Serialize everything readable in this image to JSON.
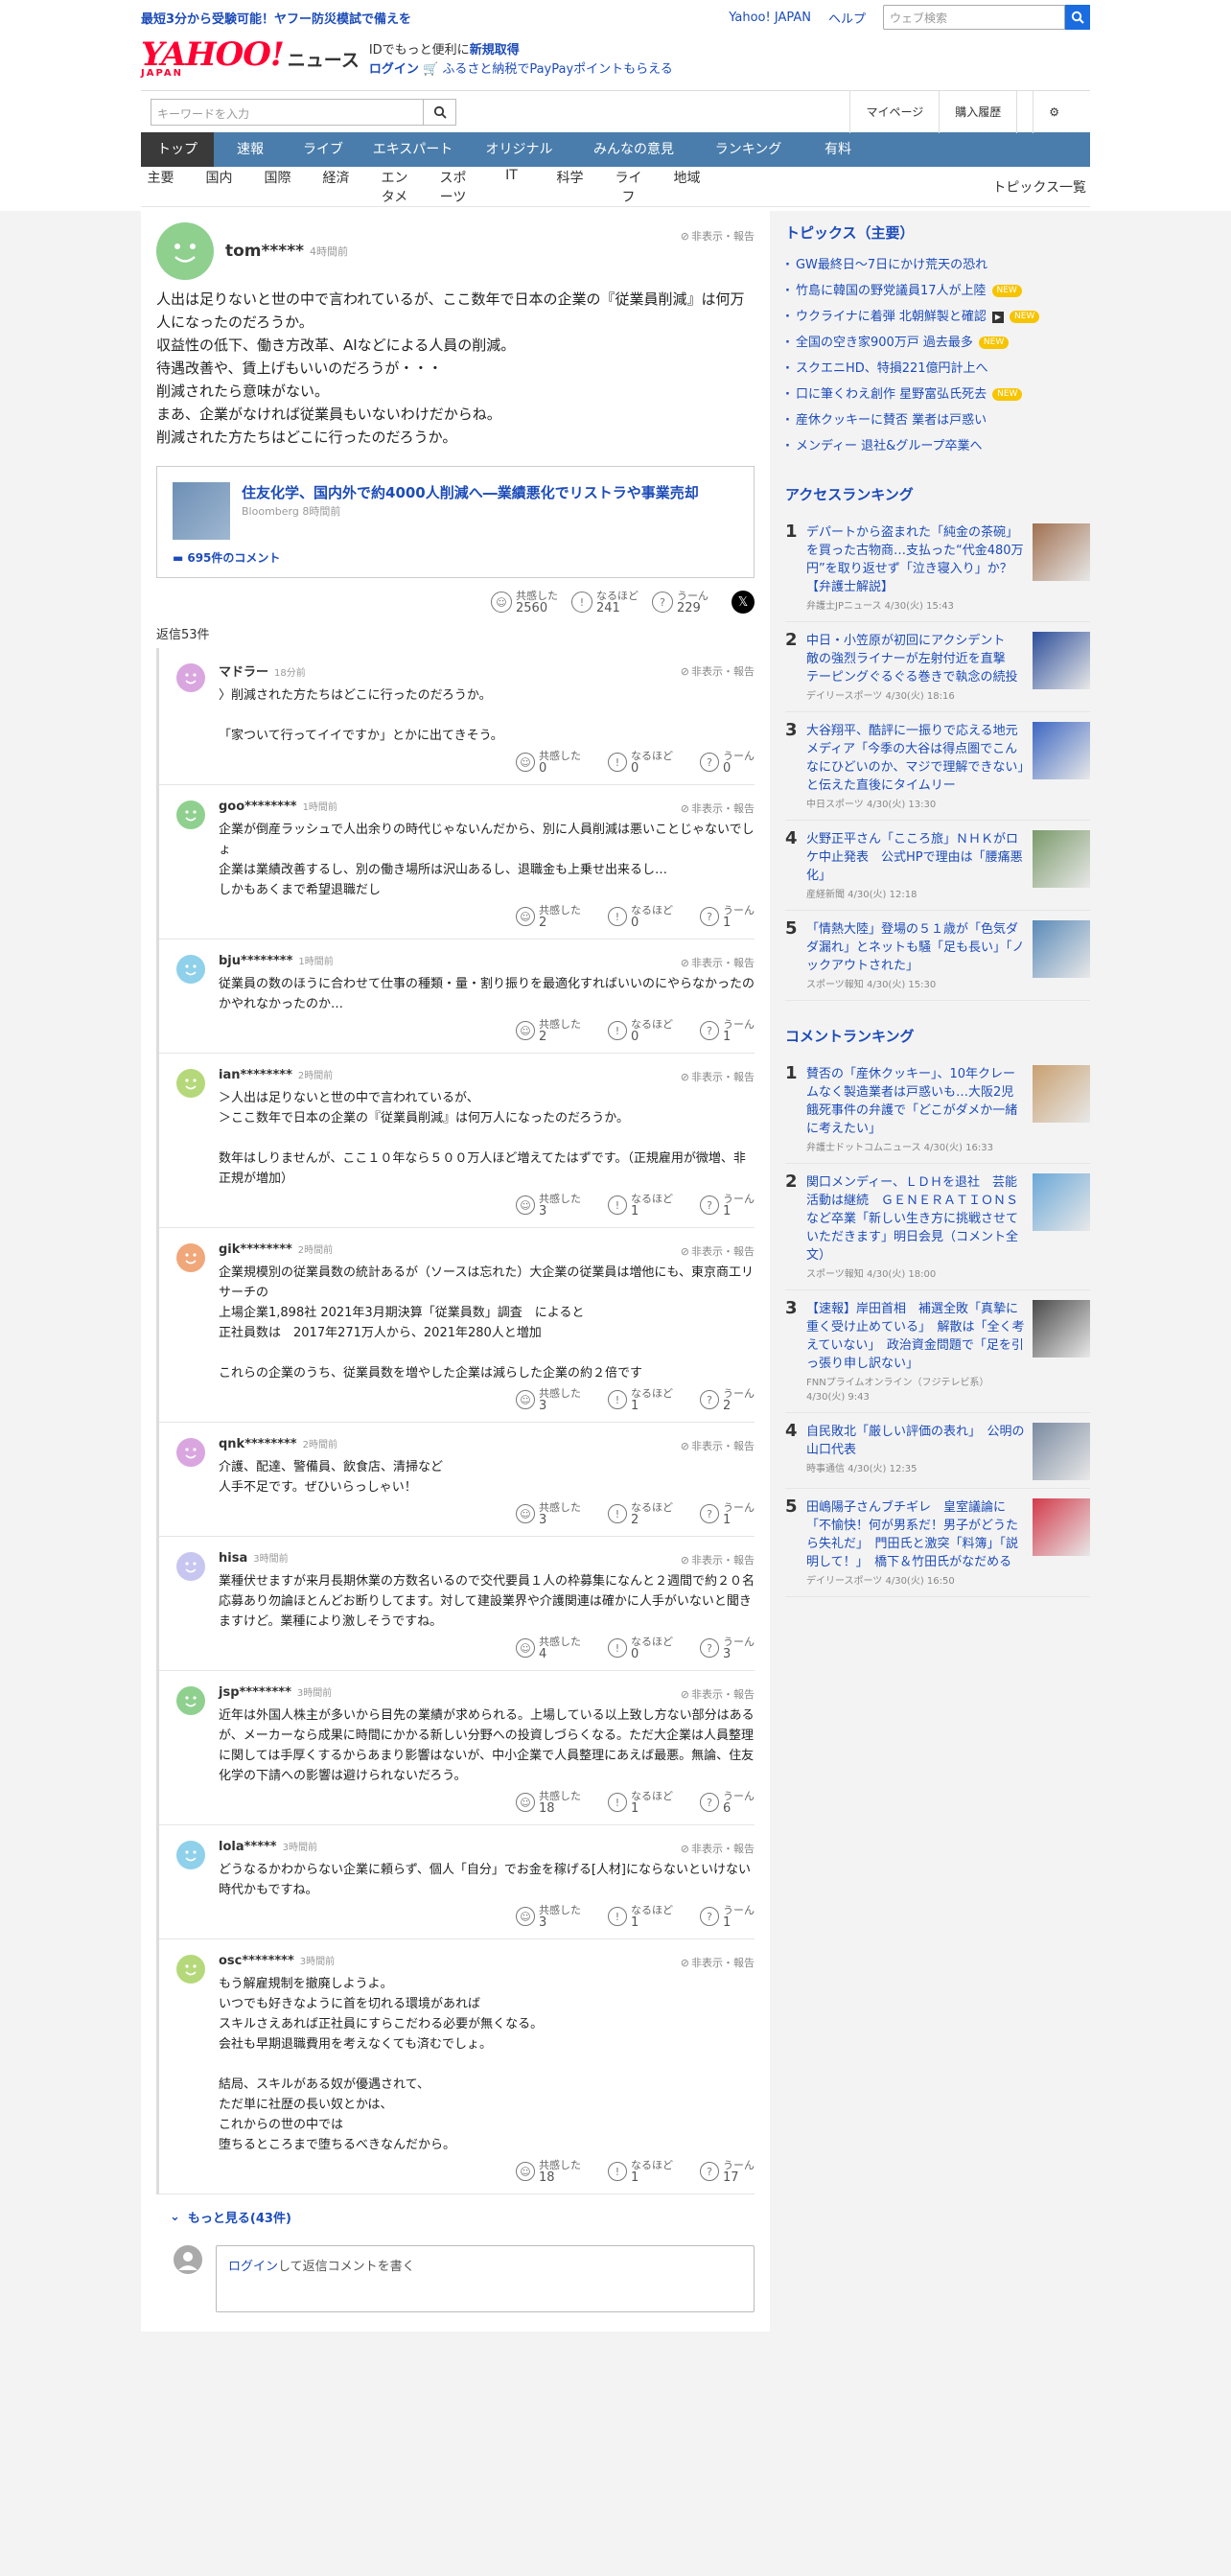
{
  "promo_link": "最短3分から受験可能！ヤフー防災模試で備えを",
  "top_links": [
    "Yahoo! JAPAN",
    "ヘルプ"
  ],
  "web_search_placeholder": "ウェブ検索",
  "logo": {
    "main": "YAHOO!",
    "sub": "JAPAN",
    "section": "ニュース"
  },
  "header_promo": {
    "line1a": "IDでもっと便利に",
    "line1b": "新規取得",
    "login": "ログイン",
    "line2": "ふるさと納税でPayPayポイントもらえる"
  },
  "keyword_placeholder": "キーワードを入力",
  "util_links": [
    "マイページ",
    "購入履歴"
  ],
  "gnav": [
    "トップ",
    "速報",
    "ライブ",
    "エキスパート",
    "オリジナル",
    "みんなの意見",
    "ランキング",
    "有料"
  ],
  "snav": [
    "主要",
    "国内",
    "国際",
    "経済",
    "エンタメ",
    "スポーツ",
    "IT",
    "科学",
    "ライフ",
    "地域"
  ],
  "topics_list_label": "トピックス一覧",
  "hide_report": "非表示・報告",
  "reaction_labels": [
    "共感した",
    "なるほど",
    "うーん"
  ],
  "post": {
    "user": "tom*****",
    "time": "4時間前",
    "text": "人出は足りないと世の中で言われているが、ここ数年で日本の企業の『従業員削減』は何万人になったのだろうか。\n収益性の低下、働き方改革、AIなどによる人員の削減。\n待遇改善や、賃上げもいいのだろうが・・・\n削減されたら意味がない。\nまあ、企業がなければ従業員もいないわけだからね。\n削減された方たちはどこに行ったのだろうか。",
    "article_title": "住友化学、国内外で約4000人削減へ―業績悪化でリストラや事業売却",
    "article_source": "Bloomberg 8時間前",
    "comments": "695件のコメント",
    "reactions": [
      "2560",
      "241",
      "229"
    ]
  },
  "reply_count": "返信53件",
  "replies": [
    {
      "user": "マドラー",
      "time": "18分前",
      "text": "〉削減された方たちはどこに行ったのだろうか。\n\n「家ついて行ってイイですか」とかに出てきそう。",
      "r": [
        "0",
        "0",
        "0"
      ],
      "color": "#d9a6e0"
    },
    {
      "user": "goo********",
      "time": "1時間前",
      "text": "企業が倒産ラッシュで人出余りの時代じゃないんだから、別に人員削減は悪いことじゃないでしょ\n企業は業績改善するし、別の働き場所は沢山あるし、退職金も上乗せ出来るし…\nしかもあくまで希望退職だし",
      "r": [
        "2",
        "0",
        "1"
      ],
      "color": "#8fd08f"
    },
    {
      "user": "bju********",
      "time": "1時間前",
      "text": "従業員の数のほうに合わせて仕事の種類・量・割り振りを最適化すればいいのにやらなかったのかやれなかったのか…",
      "r": [
        "2",
        "0",
        "1"
      ],
      "color": "#8fd0ea"
    },
    {
      "user": "ian********",
      "time": "2時間前",
      "text": "＞人出は足りないと世の中で言われているが、\n＞ここ数年で日本の企業の『従業員削減』は何万人になったのだろうか。\n\n数年はしりませんが、ここ１０年なら５００万人ほど増えてたはずです。（正規雇用が微増、非正規が増加）",
      "r": [
        "3",
        "1",
        "1"
      ],
      "color": "#b5d97a"
    },
    {
      "user": "gik********",
      "time": "2時間前",
      "text": "企業規模別の従業員数の統計あるが（ソースは忘れた）大企業の従業員は増他にも、東京商工リサーチの\n上場企業1,898社 2021年3月期決算「従業員数」調査　によると\n正社員数は　2017年271万人から、2021年280人と増加\n\nこれらの企業のうち、従業員数を増やした企業は減らした企業の約２倍です",
      "r": [
        "3",
        "1",
        "2"
      ],
      "color": "#f0a77a"
    },
    {
      "user": "qnk********",
      "time": "2時間前",
      "text": "介護、配達、警備員、飲食店、清掃など\n人手不足です。ぜひいらっしゃい！",
      "r": [
        "3",
        "2",
        "1"
      ],
      "color": "#d9a6e0"
    },
    {
      "user": "hisa",
      "time": "3時間前",
      "text": "業種伏せますが来月長期休業の方数名いるので交代要員１人の枠募集になんと２週間で約２０名応募あり勿論ほとんどお断りしてます。対して建設業界や介護関連は確かに人手がいないと聞きますけど。業種により激しそうですね。",
      "r": [
        "4",
        "0",
        "3"
      ],
      "color": "#c6c6f0"
    },
    {
      "user": "jsp********",
      "time": "3時間前",
      "text": "近年は外国人株主が多いから目先の業績が求められる。上場している以上致し方ない部分はあるが、メーカーなら成果に時間にかかる新しい分野への投資しづらくなる。ただ大企業は人員整理に関しては手厚くするからあまり影響はないが、中小企業で人員整理にあえば最悪。無論、住友化学の下請への影響は避けられないだろう。",
      "r": [
        "18",
        "1",
        "6"
      ],
      "color": "#8fd08f"
    },
    {
      "user": "lola*****",
      "time": "3時間前",
      "text": "どうなるかわからない企業に頼らず、個人「自分」でお金を稼げる[人材]にならないといけない時代かもですね。",
      "r": [
        "3",
        "1",
        "1"
      ],
      "color": "#8fd0ea"
    },
    {
      "user": "osc********",
      "time": "3時間前",
      "text": "もう解雇規制を撤廃しようよ。\nいつでも好きなように首を切れる環境があれば\nスキルさえあれば正社員にすらこだわる必要が無くなる。\n会社も早期退職費用を考えなくても済むでしょ。\n\n結局、スキルがある奴が優遇されて、\nただ単に社歴の長い奴とかは、\nこれからの世の中では\n堕ちるところまで堕ちるべきなんだから。",
      "r": [
        "18",
        "1",
        "17"
      ],
      "color": "#b5d97a"
    }
  ],
  "more_label": "もっと見る(43件)",
  "write": {
    "login": "ログイン",
    "rest": "して返信コメントを書く"
  },
  "topics": {
    "title": "トピックス（主要）",
    "items": [
      {
        "t": "GW最終日〜7日にかけ荒天の恐れ",
        "badge": ""
      },
      {
        "t": "竹島に韓国の野党議員17人が上陸",
        "badge": "NEW"
      },
      {
        "t": "ウクライナに着弾 北朝鮮製と確認",
        "badge": "NEW",
        "video": "▶"
      },
      {
        "t": "全国の空き家900万戸 過去最多",
        "badge": "NEW"
      },
      {
        "t": "スクエニHD、特損221億円計上へ",
        "badge": ""
      },
      {
        "t": "口に筆くわえ創作 星野富弘氏死去",
        "badge": "NEW"
      },
      {
        "t": "産休クッキーに賛否 業者は戸惑い",
        "badge": ""
      },
      {
        "t": "メンディー 退社&グループ卒業へ",
        "badge": ""
      }
    ]
  },
  "access": {
    "title": "アクセスランキング",
    "items": [
      {
        "n": "1",
        "t": "デパートから盗まれた「純金の茶碗」を買った古物商…支払った“代金480万円”を取り返せず「泣き寝入り」か？【弁護士解説】",
        "s": "弁護士JPニュース 4/30(火) 15:43",
        "c": "#a07050"
      },
      {
        "n": "2",
        "t": "中日・小笠原が初回にアクシデント　敵の強烈ライナーが左射付近を直撃　テーピングぐるぐる巻きで執念の続投",
        "s": "デイリースポーツ 4/30(火) 18:16",
        "c": "#2d4e9a"
      },
      {
        "n": "3",
        "t": "大谷翔平、酷評に一振りで応える地元メディア「今季の大谷は得点圏でこんなにひどいのか、マジで理解できない」と伝えた直後にタイムリー",
        "s": "中日スポーツ 4/30(火) 13:30",
        "c": "#3d67c2"
      },
      {
        "n": "4",
        "t": "火野正平さん「こころ旅」ＮＨＫがロケ中止発表　公式HPで理由は「腰痛悪化」",
        "s": "産経新聞 4/30(火) 12:18",
        "c": "#7a9a6a"
      },
      {
        "n": "5",
        "t": "「情熱大陸」登場の５１歳が「色気ダダ漏れ」とネットも騒「足も長い」「ノックアウトされた」",
        "s": "スポーツ報知 4/30(火) 15:30",
        "c": "#5a8ab8"
      }
    ]
  },
  "comment_rank": {
    "title": "コメントランキング",
    "items": [
      {
        "n": "1",
        "t": "賛否の「産休クッキー」、10年クレームなく製造業者は戸惑いも…大阪2児餓死事件の弁護で「どこがダメか一緒に考えたい」",
        "s": "弁護士ドットコムニュース 4/30(火) 16:33",
        "c": "#c8a070"
      },
      {
        "n": "2",
        "t": "関口メンディー、ＬＤＨを退社　芸能活動は継続　ＧＥＮＥＲＡＴＩＯＮＳなど卒業「新しい生き方に挑戦させていただきます」明日会見（コメント全文）",
        "s": "スポーツ報知 4/30(火) 18:00",
        "c": "#6aa8d8"
      },
      {
        "n": "3",
        "t": "【速報】岸田首相　補選全敗「真摯に重く受け止めている」　解散は「全く考えていない」　政治資金問題で「足を引っ張り申し訳ない」",
        "s": "FNNプライムオンライン（フジテレビ系） 4/30(火) 9:43",
        "c": "#4a4a4a"
      },
      {
        "n": "4",
        "t": "自民敗北「厳しい評価の表れ」　公明の山口代表",
        "s": "時事通信 4/30(火) 12:35",
        "c": "#7a8aa0"
      },
      {
        "n": "5",
        "t": "田嶋陽子さんブチギレ　皇室議論に「不愉快！何が男系だ！男子がどうたら失礼だ」　門田氏と激突「料簿」「説明して！」　橋下＆竹田氏がなだめる",
        "s": "デイリースポーツ 4/30(火) 16:50",
        "c": "#d23a4a"
      }
    ]
  }
}
